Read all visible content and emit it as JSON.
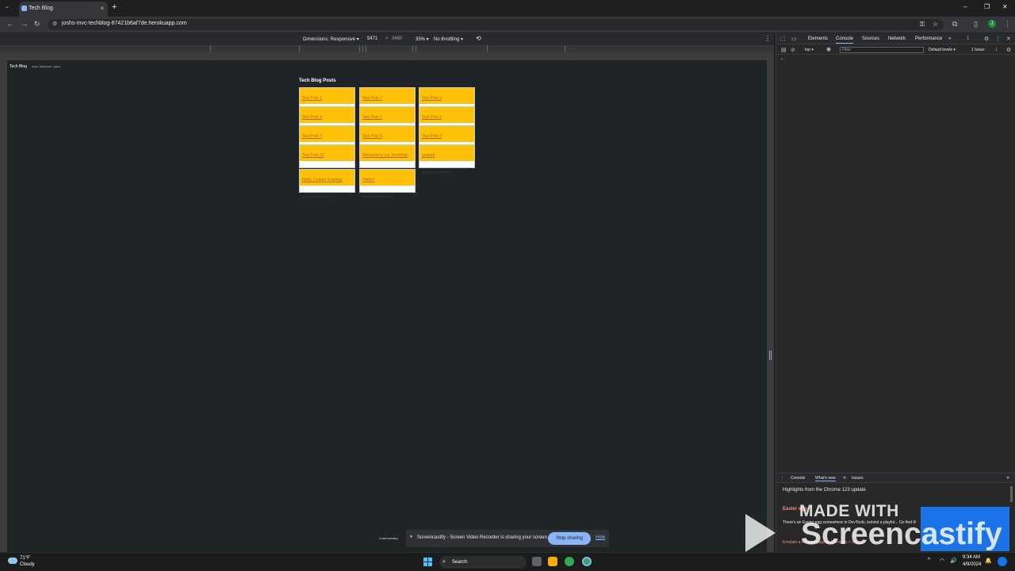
{
  "browser": {
    "tab_title": "Tech Blog",
    "tab_close": "×",
    "new_tab": "+",
    "tab_search": "⌄",
    "url": "joshs-mvc-techblog-87421b6af7de.herokuapp.com",
    "avatar_letter": "J",
    "window_controls": {
      "minimize": "–",
      "maximize": "❐",
      "close": "✕"
    },
    "nav": {
      "back": "←",
      "forward": "→",
      "reload": "↻"
    }
  },
  "device_toolbar": {
    "dimensions": "Dimensions: Responsive ▾",
    "width": "5471",
    "times": "×",
    "height": "3480",
    "zoom": "35% ▾",
    "throttling": "No throttling ▾",
    "rotate": "⟲",
    "more": "⋮"
  },
  "site": {
    "title": "Tech Blog",
    "nav": [
      "Home",
      "Dashboard",
      "Logout"
    ],
    "heading": "Tech Blog Posts",
    "footer": "© 2024 Tech Blog",
    "posts": [
      {
        "title": "Test Post 1",
        "meta": "created by: user1 on 2/25/2024 12:11"
      },
      {
        "title": "Test Post 2",
        "meta": "created by: user1 on 2/25/2024 12:03"
      },
      {
        "title": "Test Post 3",
        "meta": "created by: user1 on 2/25/2024 12:03"
      },
      {
        "title": "Test Post 4",
        "meta": "created by: user1 on 2/25/2024 12:11"
      },
      {
        "title": "Test Post 5",
        "meta": "created by: user1 on 2/25/2024 12:03"
      },
      {
        "title": "Test Post 6",
        "meta": "created by: user1 on 2/25/2024 12:03"
      },
      {
        "title": "Test Post 7",
        "meta": "created by: user1 on 2/25/2024 12:11"
      },
      {
        "title": "Test Post 8",
        "meta": "created by: user1 on 2/25/2024 12:03"
      },
      {
        "title": "Test Post 9",
        "meta": "created by: user1 on 2/25/2024 12:03"
      },
      {
        "title": "Test Post 10",
        "meta": "created by: user1 on 2/25/2024 12:11"
      },
      {
        "title": "Welcome to my Techblog!",
        "meta": "created by: user1 on 4/1/2024 17:20"
      },
      {
        "title": "asdasd",
        "meta": "created by: user1 on 4/9/2024 9:30"
      },
      {
        "title": "Hello, Central Grading!",
        "meta": "created by: grader on 4/9/2024 9:31"
      },
      {
        "title": "Hello!!!",
        "meta": "created by: user1 on 4/9/2024 9:33"
      }
    ]
  },
  "devtools": {
    "tabs": [
      "Elements",
      "Console",
      "Sources",
      "Network",
      "Performance"
    ],
    "more_tabs": "»",
    "issues_badge": "1",
    "context": "top ▾",
    "filter_placeholder": "Filter",
    "levels": "Default levels ▾",
    "issue_count": "1 Issue: ",
    "issue_count_num": "1",
    "prompt": "›",
    "drawer_tabs": [
      "Console",
      "What's new",
      "Issues"
    ],
    "drawer_close": "✕",
    "highlights": "Highlights from the Chrome 123 update",
    "easter_title": "Easter egg",
    "easter_desc": "There's an Easter egg somewhere in DevTools, behind a playful... Go find it!",
    "emulate": "Emulate a focused page in Elements > Styles"
  },
  "watermark": {
    "made_with": "MADE WITH",
    "brand": "Screencastify"
  },
  "share_bar": {
    "pause": "⏸",
    "text": "Screencastify - Screen Video Recorder is sharing your screen.",
    "stop": "Stop sharing",
    "hide": "Hide"
  },
  "taskbar": {
    "temp": "71°F",
    "condition": "Cloudy",
    "search": "Search",
    "search_icon": "⌕",
    "time": "9:34 AM",
    "date": "4/9/2024",
    "tray_up": "^",
    "wifi": "◠",
    "volume": "🔊"
  }
}
